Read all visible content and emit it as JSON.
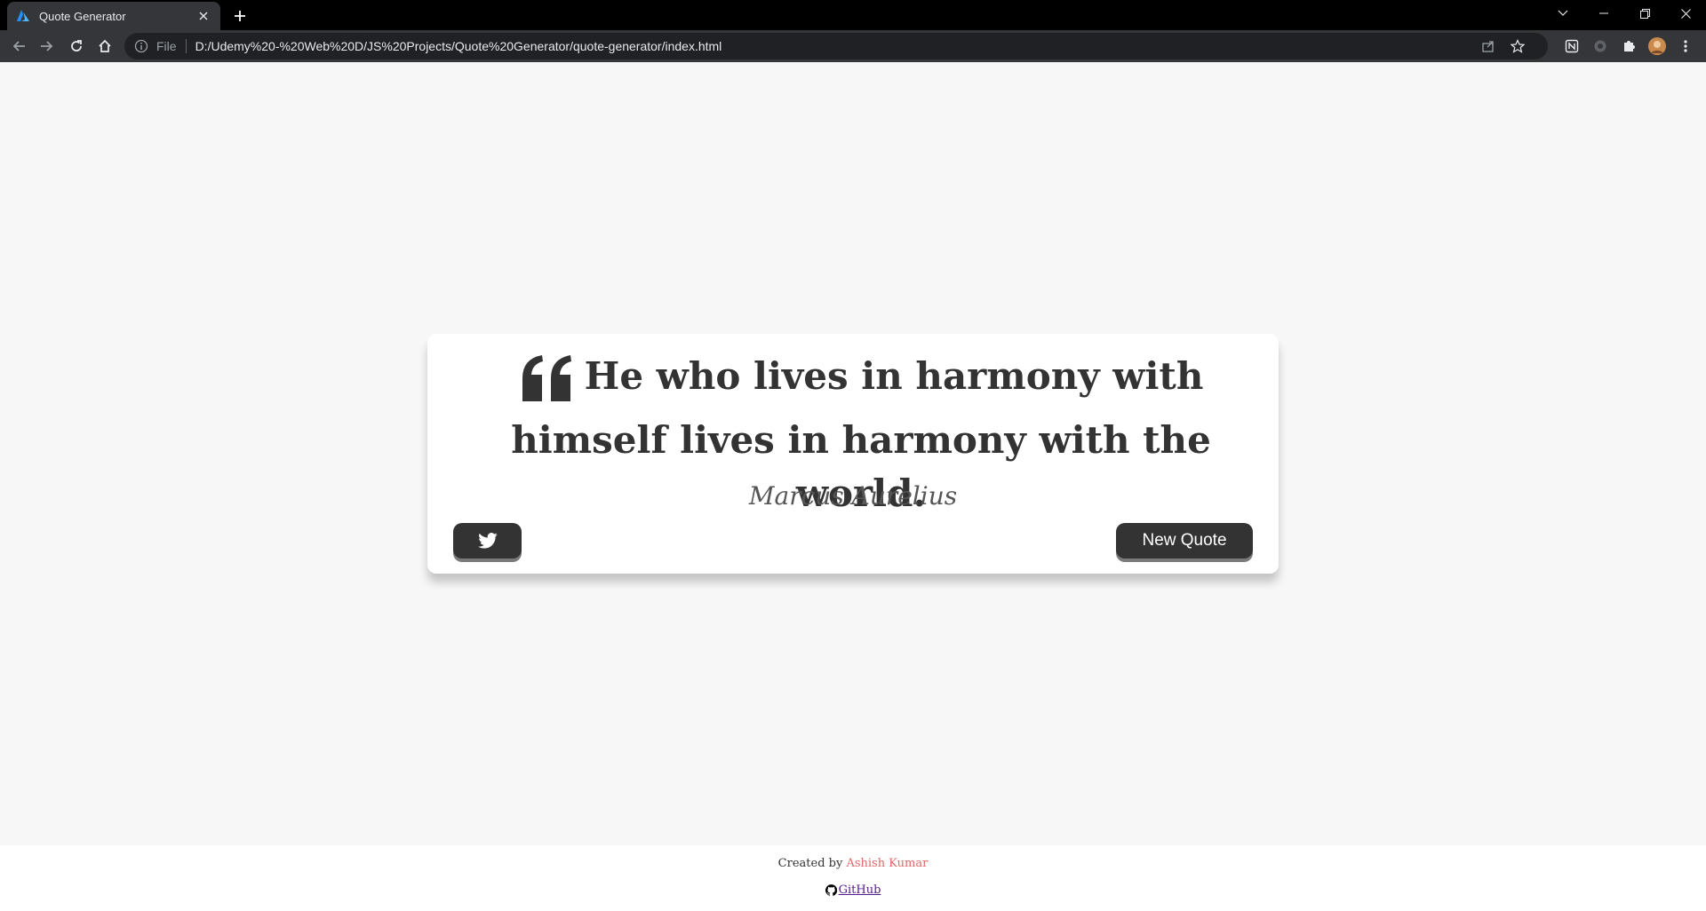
{
  "browser": {
    "tab_title": "Quote Generator",
    "address_scheme_label": "File",
    "url": "D:/Udemy%20-%20Web%20D/JS%20Projects/Quote%20Generator/quote-generator/index.html"
  },
  "quote": {
    "text": "He who lives in harmony with himself lives in harmony with the world.",
    "author": "Marcus Aurelius",
    "new_quote_label": "New Quote"
  },
  "footer": {
    "created_by": "Created by",
    "author_name": "Ashish Kumar",
    "github_label": "GitHub"
  },
  "colors": {
    "button_bg": "#333333",
    "author_link": "#e06666",
    "visited_link": "#551a8b"
  }
}
